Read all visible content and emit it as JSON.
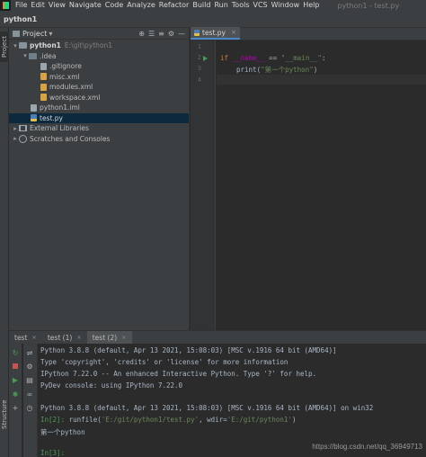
{
  "menubar": {
    "items": [
      "File",
      "Edit",
      "View",
      "Navigate",
      "Code",
      "Analyze",
      "Refactor",
      "Build",
      "Run",
      "Tools",
      "VCS",
      "Window",
      "Help"
    ],
    "window_title": "python1 - test.py"
  },
  "navbar": {
    "breadcrumb": "python1"
  },
  "left_strip": {
    "project_tab": "Project",
    "structure_tab": "Structure"
  },
  "project_panel": {
    "header_label": "Project",
    "header_dropdown": "▾",
    "tree": [
      {
        "label": "python1",
        "hint": "E:\\git\\python1",
        "type": "folder",
        "arrow": "▾",
        "indent": 0
      },
      {
        "label": ".idea",
        "type": "folder-dark",
        "arrow": "▾",
        "indent": 1
      },
      {
        "label": ".gitignore",
        "type": "gi",
        "indent": 2
      },
      {
        "label": "misc.xml",
        "type": "xml",
        "indent": 2
      },
      {
        "label": "modules.xml",
        "type": "xml",
        "indent": 2
      },
      {
        "label": "workspace.xml",
        "type": "xml",
        "indent": 2
      },
      {
        "label": "python1.iml",
        "type": "iml",
        "indent": 1
      },
      {
        "label": "test.py",
        "type": "py",
        "indent": 1,
        "selected": true
      },
      {
        "label": "External Libraries",
        "type": "lib",
        "arrow": "▸",
        "indent": 0
      },
      {
        "label": "Scratches and Consoles",
        "type": "scratch",
        "arrow": "▸",
        "indent": 0
      }
    ]
  },
  "editor": {
    "tab_label": "test.py",
    "tab_close": "×",
    "line_numbers": [
      "1",
      "2",
      "3",
      "4"
    ],
    "code": {
      "l2_kw": "if",
      "l2_name": "__name__",
      "l2_op": " == ",
      "l2_str": "\"__main__\"",
      "l2_colon": ":",
      "l3_fn": "print",
      "l3_open": "(",
      "l3_str": "\"第一个python\"",
      "l3_close": ")"
    }
  },
  "console_tabs": [
    {
      "label": "test",
      "close": "×"
    },
    {
      "label": "test (1)",
      "close": "×"
    },
    {
      "label": "test (2)",
      "close": "×",
      "active": true
    }
  ],
  "console": {
    "line1": "Python 3.8.8 (default, Apr 13 2021, 15:08:03) [MSC v.1916 64 bit (AMD64)]",
    "line2": "Type 'copyright', 'credits' or 'license' for more information",
    "line3": "IPython 7.22.0 -- An enhanced Interactive Python. Type '?' for help.",
    "line4": "PyDev console: using IPython 7.22.0",
    "line5": "Python 3.8.8 (default, Apr 13 2021, 15:08:03) [MSC v.1916 64 bit (AMD64)] on win32",
    "line6_prompt": "In[2]:",
    "line6_code_a": " runfile(",
    "line6_str_a": "'E:/git/python1/test.py'",
    "line6_code_b": ", wdir=",
    "line6_str_b": "'E:/git/python1'",
    "line6_code_c": ")",
    "line7": "第一个python",
    "line8_prompt": "In[3]:"
  },
  "watermark": "https://blog.csdn.net/qq_36949713",
  "colors": {
    "bg": "#2b2b2b",
    "panel": "#3c3f41",
    "selection": "#0d293e",
    "keyword": "#cc7832",
    "string": "#6a8759",
    "dunder": "#b200b2",
    "prompt": "#499c54"
  }
}
